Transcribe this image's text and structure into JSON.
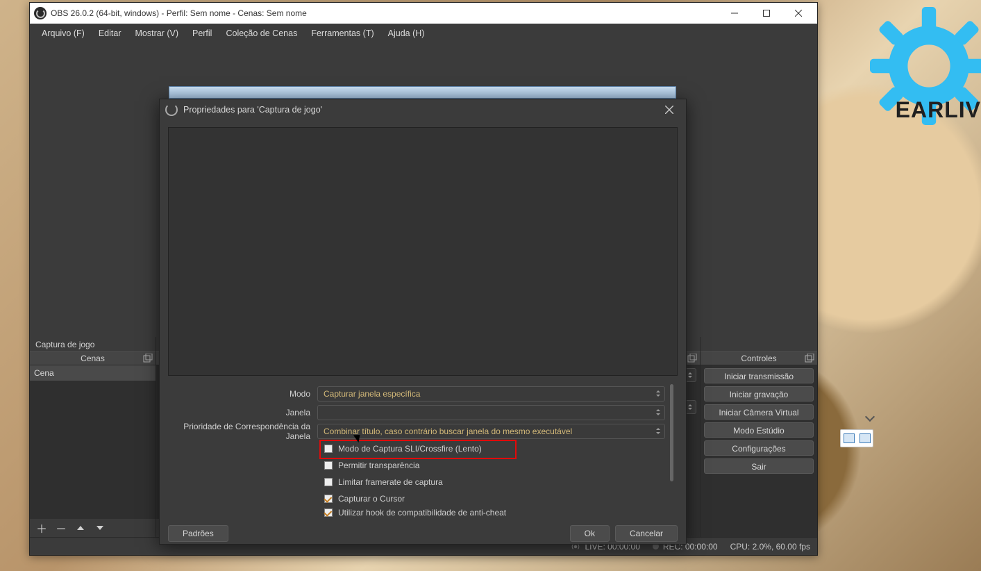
{
  "brand_text": "EARLIV",
  "titlebar": {
    "title": "OBS 26.0.2 (64-bit, windows) - Perfil: Sem nome - Cenas: Sem nome"
  },
  "menubar": {
    "arquivo": "Arquivo (F)",
    "editar": "Editar",
    "mostrar": "Mostrar (V)",
    "perfil": "Perfil",
    "colecao": "Coleção de Cenas",
    "ferramentas": "Ferramentas (T)",
    "ajuda": "Ajuda (H)"
  },
  "panels": {
    "source_top_label": "Captura de jogo",
    "cenas_header": "Cenas",
    "cena_row": "Cena",
    "controles_header": "Controles"
  },
  "controls": {
    "iniciar_transmissao": "Iniciar transmissão",
    "iniciar_gravacao": "Iniciar gravação",
    "iniciar_camera": "Iniciar Câmera Virtual",
    "modo_estudio": "Modo Estúdio",
    "configuracoes": "Configurações",
    "sair": "Sair"
  },
  "statusbar": {
    "live": "LIVE: 00:00:00",
    "rec": "REC: 00:00:00",
    "cpu": "CPU: 2.0%, 60.00 fps"
  },
  "dialog": {
    "title": "Propriedades para 'Captura de jogo'",
    "modo_label": "Modo",
    "modo_value": "Capturar janela específica",
    "janela_label": "Janela",
    "janela_value": "",
    "prior_label": "Prioridade de Correspondência da Janela",
    "prior_value": "Combinar título, caso contrário buscar janela do mesmo executável",
    "check_sli": "Modo de Captura SLI/Crossfire (Lento)",
    "check_transparencia": "Permitir transparência",
    "check_framerate": "Limitar framerate de captura",
    "check_cursor": "Capturar o Cursor",
    "check_anticheat": "Utilizar hook de compatibilidade de anti-cheat",
    "padroes": "Padrões",
    "ok": "Ok",
    "cancelar": "Cancelar"
  }
}
